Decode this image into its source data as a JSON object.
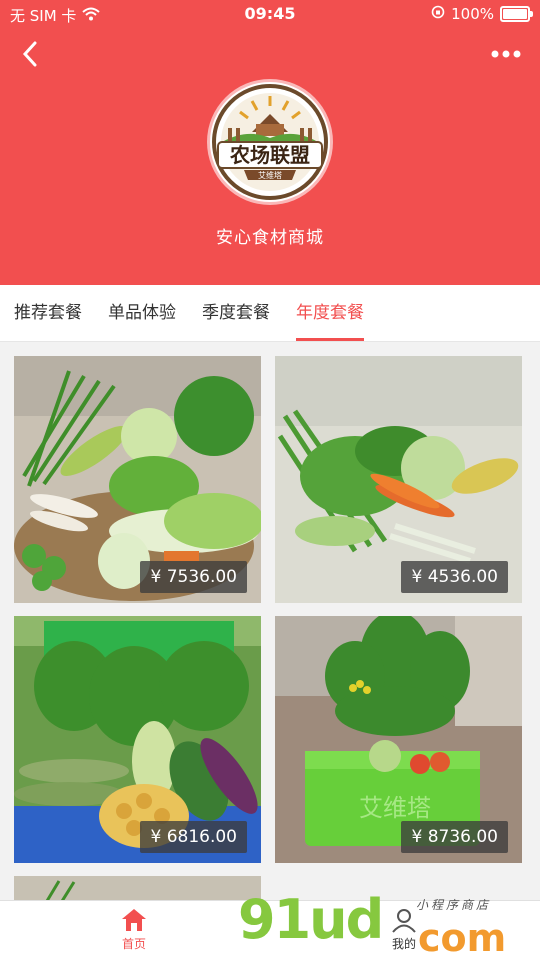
{
  "status": {
    "carrier": "无 SIM 卡",
    "time": "09:45",
    "battery": "100%"
  },
  "header": {
    "shop_name": "安心食材商城",
    "logo_text": "农场联盟",
    "logo_sub": "艾维塔"
  },
  "tabs": [
    {
      "label": "推荐套餐",
      "active": false
    },
    {
      "label": "单品体验",
      "active": false
    },
    {
      "label": "季度套餐",
      "active": false
    },
    {
      "label": "年度套餐",
      "active": true
    }
  ],
  "products": [
    {
      "price": "¥ 7536.00"
    },
    {
      "price": "¥ 4536.00"
    },
    {
      "price": "¥ 6816.00"
    },
    {
      "price": "¥ 8736.00"
    }
  ],
  "tabbar": {
    "home": "首页",
    "mine": "我的"
  },
  "watermark": {
    "main": "91ud",
    "com": "com",
    "small": "小程序商店"
  },
  "colors": {
    "accent": "#f24f4f",
    "price_bg": "#3c3c3c"
  }
}
